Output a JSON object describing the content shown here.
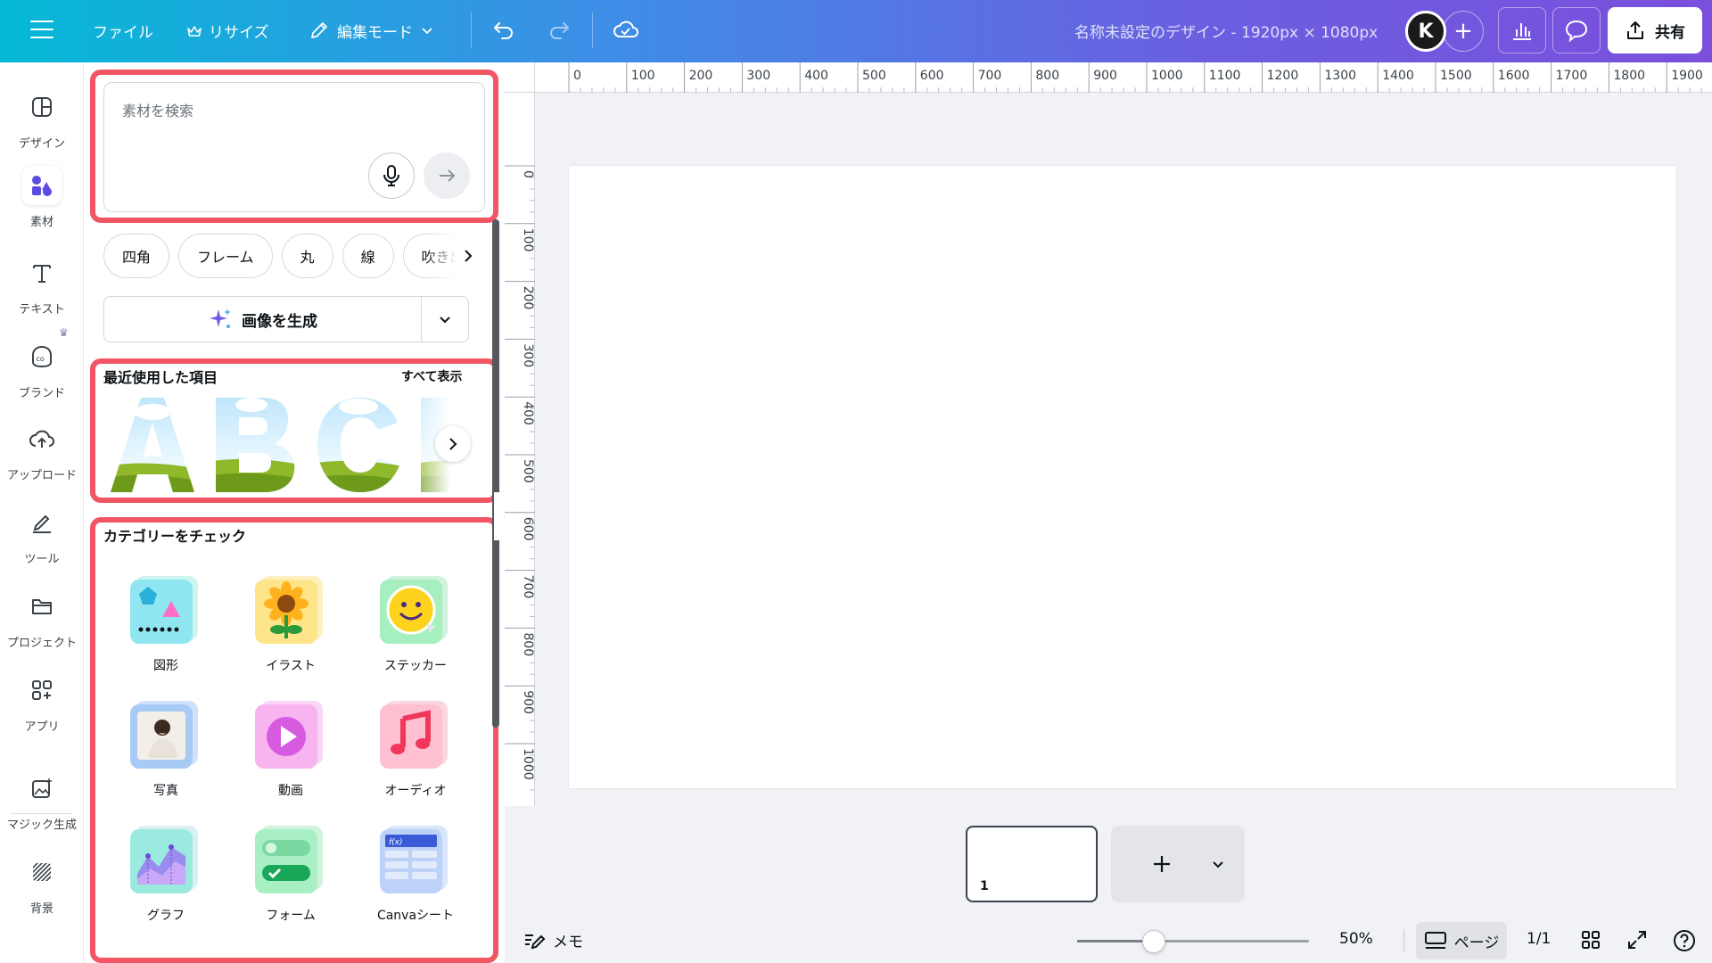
{
  "topbar": {
    "file_label": "ファイル",
    "resize_label": "リサイズ",
    "edit_mode_label": "編集モード",
    "design_title": "名称未設定のデザイン - 1920px × 1080px",
    "avatar_letter": "K",
    "share_label": "共有",
    "brand_gradient": [
      "#05b9d6",
      "#7a4fdc"
    ]
  },
  "rail": {
    "items": [
      {
        "label": "デザイン",
        "icon": "layout-icon"
      },
      {
        "label": "素材",
        "icon": "shapes-icon",
        "active": true
      },
      {
        "label": "テキスト",
        "icon": "text-icon"
      },
      {
        "label": "ブランド",
        "icon": "brand-icon"
      },
      {
        "label": "アップロード",
        "icon": "upload-cloud-icon"
      },
      {
        "label": "ツール",
        "icon": "pen-tool-icon"
      },
      {
        "label": "プロジェクト",
        "icon": "folder-icon"
      },
      {
        "label": "アプリ",
        "icon": "apps-icon"
      },
      {
        "label": "マジック生成",
        "icon": "magic-image-icon"
      },
      {
        "label": "背景",
        "icon": "background-icon"
      }
    ]
  },
  "panel": {
    "search_placeholder": "素材を検索",
    "chips": [
      "四角",
      "フレーム",
      "丸",
      "線",
      "吹き出"
    ],
    "generate_label": "画像を生成",
    "recent_title": "最近使用した項目",
    "see_all_label": "すべて表示",
    "categories_title": "カテゴリーをチェック",
    "categories": [
      {
        "label": "図形",
        "icon": "shapes-category-icon"
      },
      {
        "label": "イラスト",
        "icon": "sunflower-icon"
      },
      {
        "label": "ステッカー",
        "icon": "smiley-sticker-icon"
      },
      {
        "label": "写真",
        "icon": "photo-icon"
      },
      {
        "label": "動画",
        "icon": "video-play-icon"
      },
      {
        "label": "オーディオ",
        "icon": "music-note-icon"
      },
      {
        "label": "グラフ",
        "icon": "graph-icon"
      },
      {
        "label": "フォーム",
        "icon": "form-toggle-icon"
      },
      {
        "label": "Canvaシート",
        "icon": "sheet-icon"
      }
    ],
    "highlight_color": "#f25563"
  },
  "ruler": {
    "top_ticks": [
      "0",
      "100",
      "200",
      "300",
      "400",
      "500",
      "600",
      "700",
      "800",
      "900",
      "1000",
      "1100",
      "1200",
      "1300",
      "1400",
      "1500",
      "1600",
      "1700",
      "1800",
      "1900"
    ],
    "left_ticks": [
      "0",
      "100",
      "200",
      "300",
      "400",
      "500",
      "600",
      "700",
      "800",
      "900",
      "1000"
    ]
  },
  "pages": {
    "thumb_number": "1"
  },
  "bottombar": {
    "memo_label": "メモ",
    "zoom_value": "50%",
    "zoom_fraction": 0.33,
    "pages_label": "ページ",
    "page_count": "1/1"
  }
}
